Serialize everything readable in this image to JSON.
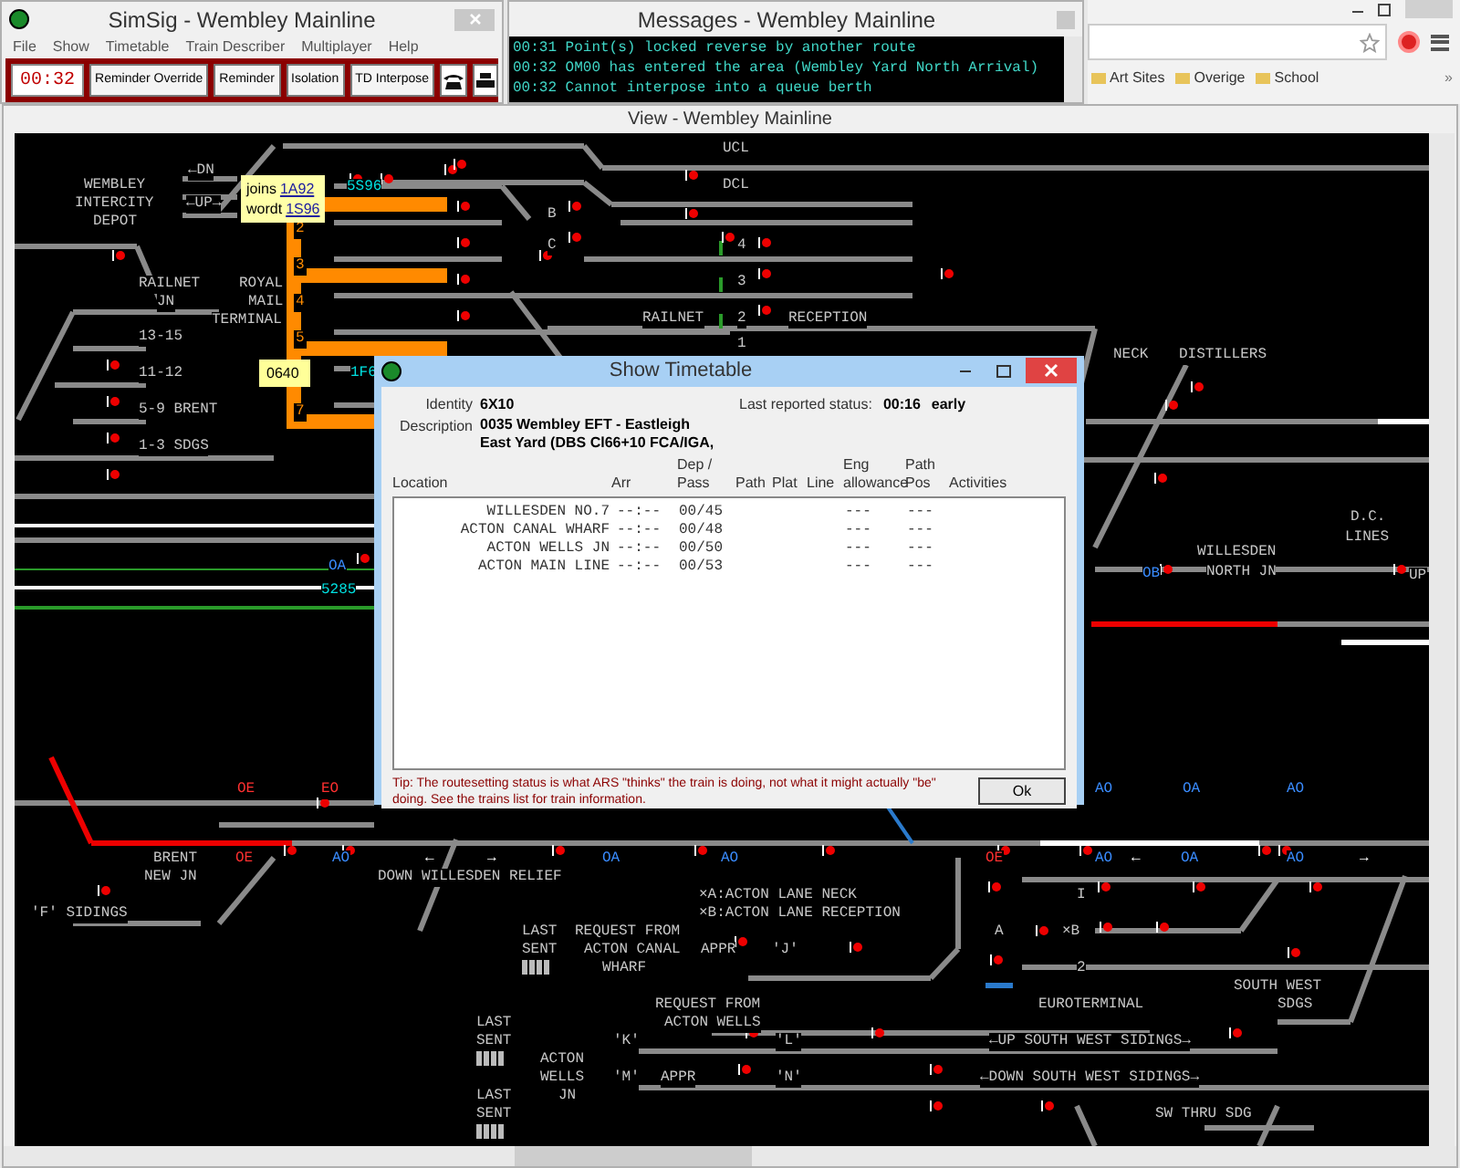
{
  "simsig": {
    "title": "SimSig - Wembley Mainline",
    "menu": [
      "File",
      "Show",
      "Timetable",
      "Train Describer",
      "Multiplayer",
      "Help"
    ],
    "clock": "00:32",
    "buttons": [
      "Reminder Override",
      "Reminder",
      "Isolation",
      "TD Interpose"
    ]
  },
  "messages": {
    "title": "Messages - Wembley Mainline",
    "lines": [
      "00:31 Point(s) locked reverse by another route",
      "00:32 OM00 has entered the area (Wembley Yard North Arrival)",
      "00:32 Cannot interpose into a queue berth"
    ]
  },
  "browser": {
    "bookmarks": [
      "Art Sites",
      "Overige",
      "School"
    ],
    "overflow": "»"
  },
  "view": {
    "title": "View - Wembley Mainline",
    "labels": [
      {
        "text": "←DN",
        "kind": "location"
      },
      {
        "text": "WEMBLEY",
        "kind": "location"
      },
      {
        "text": "INTERCITY",
        "kind": "location"
      },
      {
        "text": "DEPOT",
        "kind": "location"
      },
      {
        "text": "←UP→",
        "kind": "location"
      },
      {
        "text": "5S96",
        "kind": "train"
      },
      {
        "text": "RAILNET",
        "kind": "location"
      },
      {
        "text": "JN",
        "kind": "location"
      },
      {
        "text": "ROYAL",
        "kind": "location"
      },
      {
        "text": "MAIL",
        "kind": "location"
      },
      {
        "text": "TERMINAL",
        "kind": "location"
      },
      {
        "text": "2",
        "kind": "platform"
      },
      {
        "text": "3",
        "kind": "platform"
      },
      {
        "text": "4",
        "kind": "platform"
      },
      {
        "text": "5",
        "kind": "platform"
      },
      {
        "text": "7",
        "kind": "platform"
      },
      {
        "text": "13-15",
        "kind": "location"
      },
      {
        "text": "11-12",
        "kind": "location"
      },
      {
        "text": "5-9 BRENT",
        "kind": "location"
      },
      {
        "text": "1-3 SDGS",
        "kind": "location"
      },
      {
        "text": "1F6",
        "kind": "train"
      },
      {
        "text": "UCL",
        "kind": "location"
      },
      {
        "text": "DCL",
        "kind": "location"
      },
      {
        "text": "B",
        "kind": "location"
      },
      {
        "text": "C",
        "kind": "location"
      },
      {
        "text": "4",
        "kind": "location"
      },
      {
        "text": "3",
        "kind": "location"
      },
      {
        "text": "RAILNET",
        "kind": "location"
      },
      {
        "text": "2",
        "kind": "location"
      },
      {
        "text": "RECEPTION",
        "kind": "location"
      },
      {
        "text": "1",
        "kind": "location"
      },
      {
        "text": "NECK",
        "kind": "location"
      },
      {
        "text": "DISTILLERS",
        "kind": "location"
      },
      {
        "text": "D.C.",
        "kind": "location"
      },
      {
        "text": "LINES",
        "kind": "location"
      },
      {
        "text": "OA",
        "kind": "signal_blue"
      },
      {
        "text": "5285",
        "kind": "train"
      },
      {
        "text": "OB",
        "kind": "signal_blue"
      },
      {
        "text": "WILLESDEN",
        "kind": "location"
      },
      {
        "text": "NORTH JN",
        "kind": "location"
      },
      {
        "text": "UP",
        "kind": "location"
      },
      {
        "text": "OE",
        "kind": "signal_red"
      },
      {
        "text": "EO",
        "kind": "signal_red"
      },
      {
        "text": "AO",
        "kind": "signal_blue"
      },
      {
        "text": "OA",
        "kind": "signal_blue"
      },
      {
        "text": "AO",
        "kind": "signal_blue"
      },
      {
        "text": "BRENT",
        "kind": "location"
      },
      {
        "text": "NEW JN",
        "kind": "location"
      },
      {
        "text": "OE",
        "kind": "signal_red"
      },
      {
        "text": "AO",
        "kind": "signal_blue"
      },
      {
        "text": "←",
        "kind": "arrow"
      },
      {
        "text": "→",
        "kind": "arrow"
      },
      {
        "text": "DOWN WILLESDEN RELIEF",
        "kind": "location"
      },
      {
        "text": "OA",
        "kind": "signal_blue"
      },
      {
        "text": "AO",
        "kind": "signal_blue"
      },
      {
        "text": "'F' SIDINGS",
        "kind": "location"
      },
      {
        "text": "OE",
        "kind": "signal_red"
      },
      {
        "text": "AO",
        "kind": "signal_blue"
      },
      {
        "text": "←",
        "kind": "arrow"
      },
      {
        "text": "OA",
        "kind": "signal_blue"
      },
      {
        "text": "AO",
        "kind": "signal_blue"
      },
      {
        "text": "→",
        "kind": "arrow"
      },
      {
        "text": "×A:ACTON LANE NECK",
        "kind": "location"
      },
      {
        "text": "×B:ACTON LANE RECEPTION",
        "kind": "location"
      },
      {
        "text": "I",
        "kind": "location"
      },
      {
        "text": "LAST",
        "kind": "location"
      },
      {
        "text": "SENT",
        "kind": "location"
      },
      {
        "text": "REQUEST FROM",
        "kind": "location"
      },
      {
        "text": "ACTON CANAL",
        "kind": "location"
      },
      {
        "text": "WHARF",
        "kind": "location"
      },
      {
        "text": "APPR",
        "kind": "location"
      },
      {
        "text": "'J'",
        "kind": "location"
      },
      {
        "text": "A",
        "kind": "location"
      },
      {
        "text": "×B",
        "kind": "location"
      },
      {
        "text": "2",
        "kind": "location"
      },
      {
        "text": "SOUTH WEST",
        "kind": "location"
      },
      {
        "text": "REQUEST FROM",
        "kind": "location"
      },
      {
        "text": "EUROTERMINAL",
        "kind": "location"
      },
      {
        "text": "SDGS",
        "kind": "location"
      },
      {
        "text": "LAST",
        "kind": "location"
      },
      {
        "text": "ACTON WELLS",
        "kind": "location"
      },
      {
        "text": "SENT",
        "kind": "location"
      },
      {
        "text": "'K'",
        "kind": "location"
      },
      {
        "text": "'L'",
        "kind": "location"
      },
      {
        "text": "←UP SOUTH WEST SIDINGS→",
        "kind": "location"
      },
      {
        "text": "ACTON",
        "kind": "location"
      },
      {
        "text": "WELLS",
        "kind": "location"
      },
      {
        "text": "JN",
        "kind": "location"
      },
      {
        "text": "'M'",
        "kind": "location"
      },
      {
        "text": "APPR",
        "kind": "location"
      },
      {
        "text": "'N'",
        "kind": "location"
      },
      {
        "text": "←DOWN SOUTH WEST SIDINGS→",
        "kind": "location"
      },
      {
        "text": "LAST",
        "kind": "location"
      },
      {
        "text": "SENT",
        "kind": "location"
      },
      {
        "text": "SW THRU SDG",
        "kind": "location"
      }
    ],
    "popups": [
      {
        "kind": "berth_menu",
        "lines": [
          {
            "text": "joins",
            "link": "1A92"
          },
          {
            "text": "wordt",
            "link": "1S96"
          }
        ]
      },
      {
        "kind": "berth_value",
        "lines": [
          {
            "text": "0640"
          }
        ]
      }
    ]
  },
  "timetable": {
    "title": "Show Timetable",
    "identity_label": "Identity",
    "identity": "6X10",
    "description_label": "Description",
    "description_lines": [
      "0035 Wembley EFT - Eastleigh",
      "East Yard (DBS Cl66+10 FCA/IGA,"
    ],
    "status_label": "Last reported status:",
    "status_time": "00:16",
    "status": "early",
    "columns": [
      [
        "Location"
      ],
      [
        "Arr"
      ],
      [
        "Dep /",
        "Pass"
      ],
      [
        "Path"
      ],
      [
        "Plat"
      ],
      [
        "Line"
      ],
      [
        "Eng",
        "allowance"
      ],
      [
        "Path",
        "Pos"
      ],
      [
        "Activities"
      ]
    ],
    "rows": [
      {
        "location": "WILLESDEN NO.7",
        "arr": "--:--",
        "dep": "00/45",
        "eng": "---",
        "path_pos": "---"
      },
      {
        "location": "ACTON CANAL WHARF",
        "arr": "--:--",
        "dep": "00/48",
        "eng": "---",
        "path_pos": "---"
      },
      {
        "location": "ACTON WELLS JN",
        "arr": "--:--",
        "dep": "00/50",
        "eng": "---",
        "path_pos": "---"
      },
      {
        "location": "ACTON MAIN LINE",
        "arr": "--:--",
        "dep": "00/53",
        "eng": "---",
        "path_pos": "---"
      }
    ],
    "tip": "Tip: The routesetting status is what ARS \"thinks\" the train is doing, not what it might actually \"be\" doing. See the trains list for train information.",
    "ok": "Ok"
  }
}
